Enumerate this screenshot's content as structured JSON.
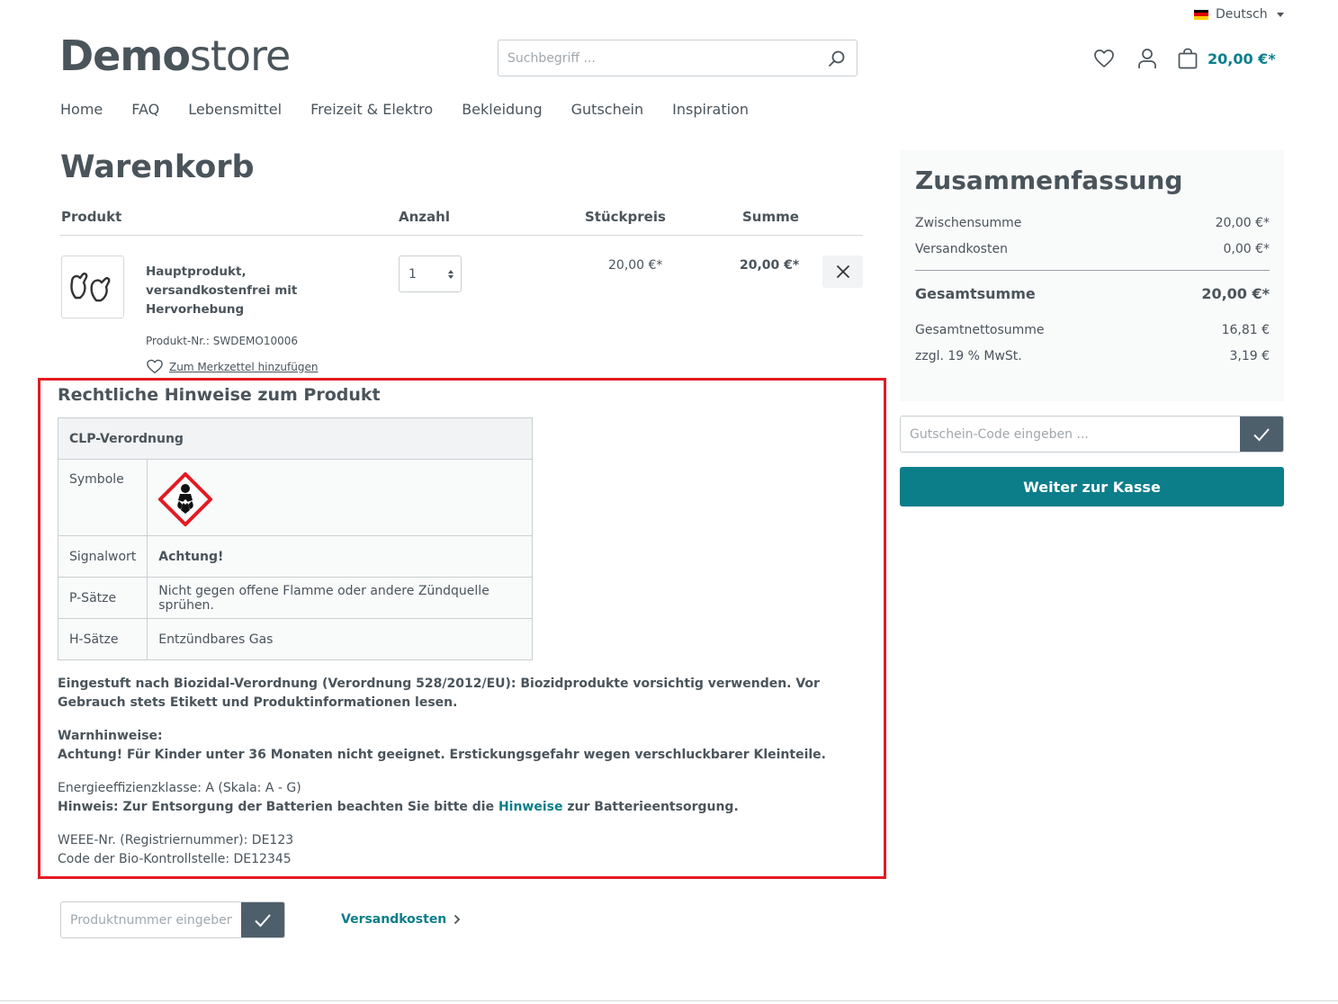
{
  "header": {
    "language": "Deutsch",
    "logo_bold": "Demo",
    "logo_light": "store",
    "search_placeholder": "Suchbegriff ...",
    "cart_total": "20,00 €*",
    "flag_colors": [
      "#000000",
      "#dd0000",
      "#ffce00"
    ]
  },
  "nav": {
    "items": [
      "Home",
      "FAQ",
      "Lebensmittel",
      "Freizeit & Elektro",
      "Bekleidung",
      "Gutschein",
      "Inspiration"
    ]
  },
  "cart": {
    "title": "Warenkorb",
    "columns": {
      "product": "Produkt",
      "quantity": "Anzahl",
      "unit_price": "Stückpreis",
      "sum": "Summe"
    },
    "item": {
      "name": "Hauptprodukt, versandkostenfrei mit Hervorhebung",
      "number": "Produkt-Nr.: SWDEMO10006",
      "wishlist": "Zum Merkzettel hinzufügen",
      "quantity": "1",
      "unit_price": "20,00 €*",
      "total": "20,00 €*",
      "thumbnail_icon": "mittens-icon"
    }
  },
  "legal": {
    "title": "Rechtliche Hinweise zum Produkt",
    "table_header": "CLP-Verordnung",
    "rows": [
      {
        "label": "Symbole",
        "value": ""
      },
      {
        "label": "Signalwort",
        "value": "Achtung!"
      },
      {
        "label": "P-Sätze",
        "value": "Nicht gegen offene Flamme oder andere Zündquelle sprühen."
      },
      {
        "label": "H-Sätze",
        "value": "Entzündbares Gas"
      }
    ],
    "hazard_icon": "health-hazard-icon",
    "biocide": "Eingestuft nach Biozidal-Verordnung (Verordnung 528/2012/EU): Biozidprodukte vorsichtig verwenden. Vor Gebrauch stets Etikett und Produktinformationen lesen.",
    "warn_title": "Warnhinweise:",
    "warn_text": "Achtung! Für Kinder unter 36 Monaten nicht geeignet. Erstickungsgefahr wegen verschluckbarer Kleinteile.",
    "energy": "Energieeffizienzklasse: A (Skala: A - G)",
    "battery_pre": "Hinweis: Zur Entsorgung der Batterien beachten Sie bitte die ",
    "battery_link": "Hinweise",
    "battery_post": " zur Batterieentsorgung.",
    "weee": "WEEE-Nr. (Registriernummer): DE123",
    "bio": "Code der Bio-Kontrollstelle: DE12345"
  },
  "bottom": {
    "product_input_placeholder": "Produktnummer eingeben ...",
    "shipping_link": "Versandkosten"
  },
  "summary": {
    "title": "Zusammenfassung",
    "subtotal_label": "Zwischensumme",
    "subtotal": "20,00 €*",
    "shipping_label": "Versandkosten",
    "shipping": "0,00 €*",
    "total_label": "Gesamtsumme",
    "total": "20,00 €*",
    "net_label": "Gesamtnettosumme",
    "net": "16,81 €",
    "tax_label": "zzgl. 19 % MwSt.",
    "tax": "3,19 €",
    "coupon_placeholder": "Gutschein-Code eingeben ...",
    "checkout": "Weiter zur Kasse"
  },
  "colors": {
    "accent": "#0b7e8a",
    "highlight": "#e31b23",
    "button_dark": "#4e5f6c"
  }
}
